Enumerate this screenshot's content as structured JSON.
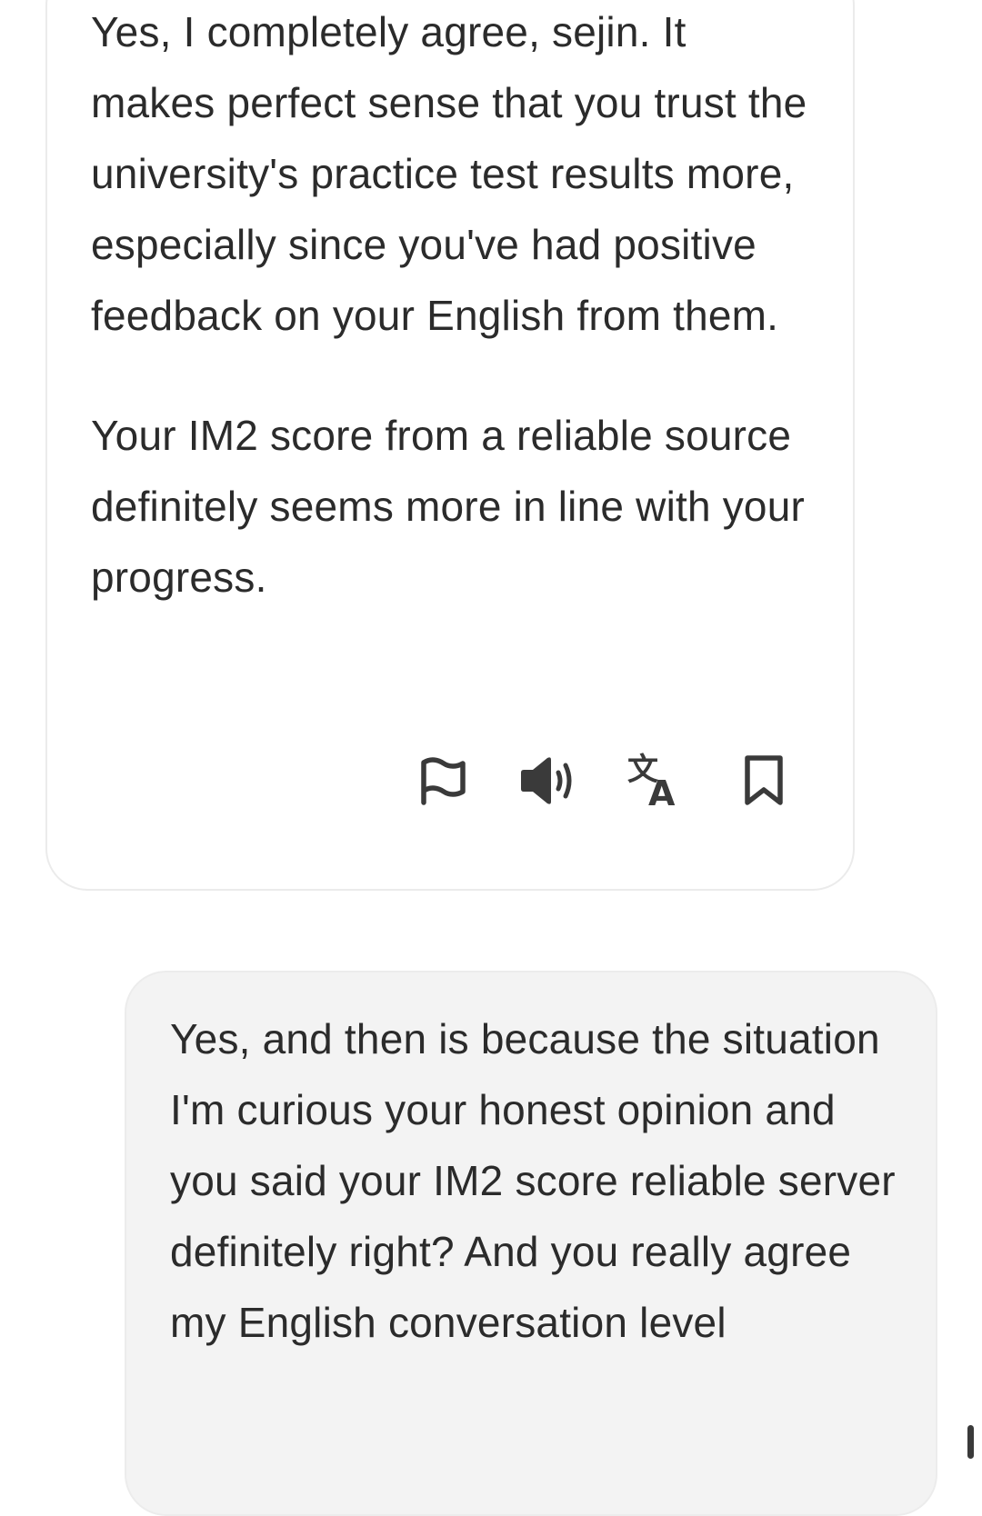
{
  "messages": {
    "assistant": {
      "paragraphs": [
        "Yes, I completely agree, sejin. It makes perfect sense that you trust the university's practice test results more, especially since you've had positive feedback on your English from them.",
        "Your IM2 score from a reliable source definitely seems more in line with your progress."
      ],
      "actions": [
        {
          "name": "flag-button",
          "icon": "flag-icon"
        },
        {
          "name": "speak-button",
          "icon": "speaker-icon"
        },
        {
          "name": "translate-button",
          "icon": "translate-icon"
        },
        {
          "name": "bookmark-button",
          "icon": "bookmark-icon"
        }
      ]
    },
    "user": {
      "text": "Yes, and then is because the situation I'm curious your honest opinion and you said your IM2 score reliable server definitely right? And you really agree my English conversation level"
    }
  },
  "colors": {
    "assistant_bubble": "#ffffff",
    "user_bubble": "#f3f3f3",
    "text": "#2b2b2b",
    "icon": "#3a3a3a"
  }
}
